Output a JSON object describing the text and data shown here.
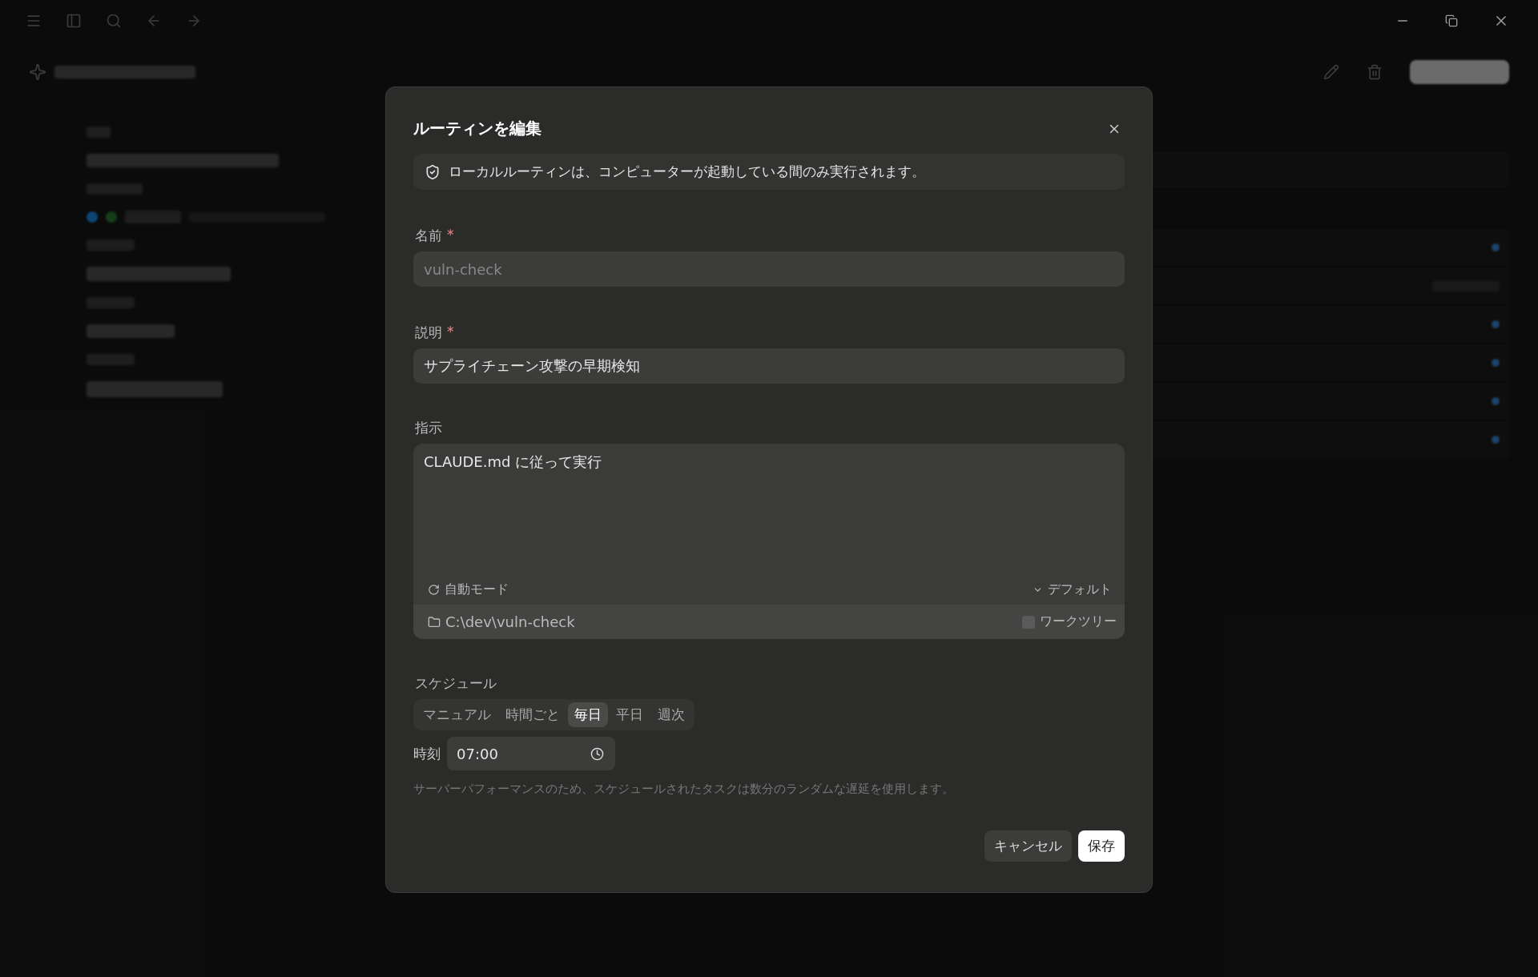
{
  "dialog": {
    "title": "ルーティンを編集",
    "notice": "ローカルルーティンは、コンピューターが起動している間のみ実行されます。",
    "name": {
      "label": "名前",
      "required_mark": "*",
      "placeholder": "vuln-check"
    },
    "description": {
      "label": "説明",
      "required_mark": "*",
      "value": "サプライチェーン攻撃の早期検知"
    },
    "instructions": {
      "label": "指示",
      "value": "CLAUDE.md に従って実行",
      "mode": "自動モード",
      "model": "デフォルト",
      "folder": "C:\\dev\\vuln-check",
      "worktree": {
        "label": "ワークツリー",
        "checked": false
      }
    },
    "schedule": {
      "label": "スケジュール",
      "options": [
        {
          "label": "マニュアル",
          "selected": false
        },
        {
          "label": "時間ごと",
          "selected": false
        },
        {
          "label": "毎日",
          "selected": true
        },
        {
          "label": "平日",
          "selected": false
        },
        {
          "label": "週次",
          "selected": false
        }
      ],
      "time_label": "時刻",
      "time": "07:00",
      "hint": "サーバーパフォーマンスのため、スケジュールされたタスクは数分のランダムな遅延を使用します。"
    },
    "buttons": [
      {
        "label": "キャンセル",
        "kind": "secondary"
      },
      {
        "label": "保存",
        "kind": "primary"
      }
    ]
  }
}
